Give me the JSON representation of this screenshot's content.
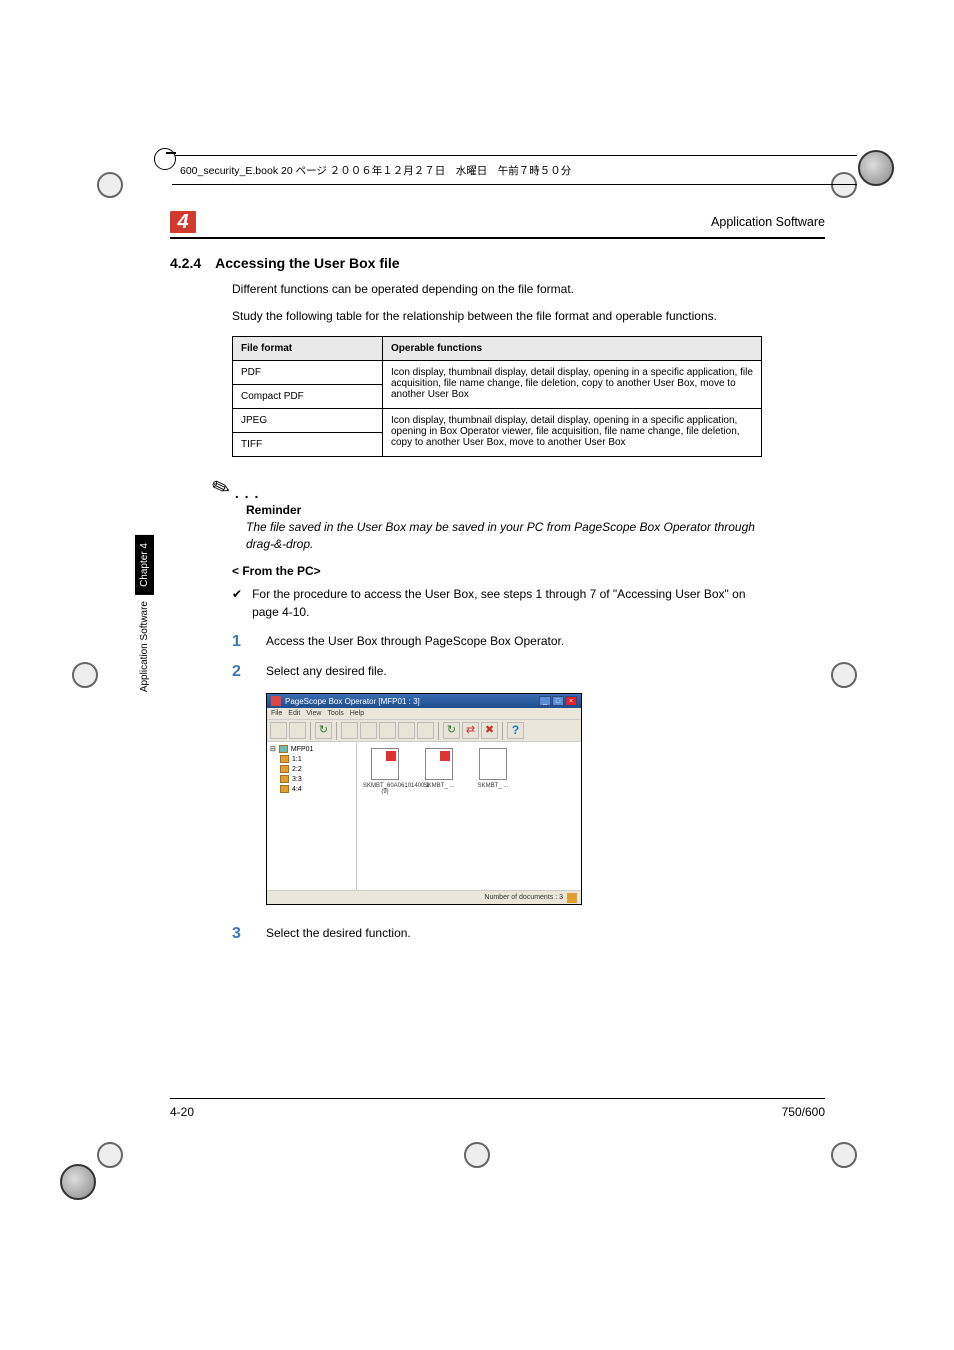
{
  "header_line": "600_security_E.book  20 ページ  ２００６年１２月２７日　水曜日　午前７時５０分",
  "chapter_badge": "4",
  "running_title": "Application Software",
  "section": {
    "num": "4.2.4",
    "title": "Accessing the User Box file"
  },
  "para1": "Different functions can be operated depending on the file format.",
  "para2": "Study the following table for the relationship between the file format and operable functions.",
  "table": {
    "headers": [
      "File format",
      "Operable functions"
    ],
    "rows": [
      [
        "PDF",
        "Icon display, thumbnail display, detail display, opening in a specific application, file acquisition, file name change, file deletion, copy to another User Box, move to another User Box"
      ],
      [
        "Compact PDF",
        ""
      ],
      [
        "JPEG",
        "Icon display, thumbnail display, detail display, opening in a specific application, opening in Box Operator viewer, file acquisition, file name change, file deletion, copy to another User Box, move to another User Box"
      ],
      [
        "TIFF",
        ""
      ]
    ]
  },
  "reminder": {
    "label": "Reminder",
    "text": "The file saved in the User Box may be saved in your PC from PageScope Box Operator through drag-&-drop."
  },
  "subhead": "< From the PC>",
  "check_text": "For the procedure to access the User Box, see steps 1 through 7 of \"Accessing User Box\" on page 4-10.",
  "steps": [
    {
      "n": "1",
      "t": "Access the User Box through PageScope Box Operator."
    },
    {
      "n": "2",
      "t": "Select any desired file."
    },
    {
      "n": "3",
      "t": "Select the desired function."
    }
  ],
  "screenshot": {
    "title": "PageScope Box Operator  [MFP01 : 3]",
    "menus": [
      "File",
      "Edit",
      "View",
      "Tools",
      "Help"
    ],
    "tree_root": "MFP01",
    "tree_items": [
      "1:1",
      "2:2",
      "3:3",
      "4:4"
    ],
    "files": [
      {
        "name": "SKMBT_60A06101400.1 (9)"
      },
      {
        "name": "SKMBT_ ..."
      },
      {
        "name": "SKMBT_ ..."
      }
    ],
    "status": "Number of documents : 3"
  },
  "side_chapter": "Chapter 4",
  "side_section": "Application Software",
  "footer_left": "4-20",
  "footer_right": "750/600"
}
